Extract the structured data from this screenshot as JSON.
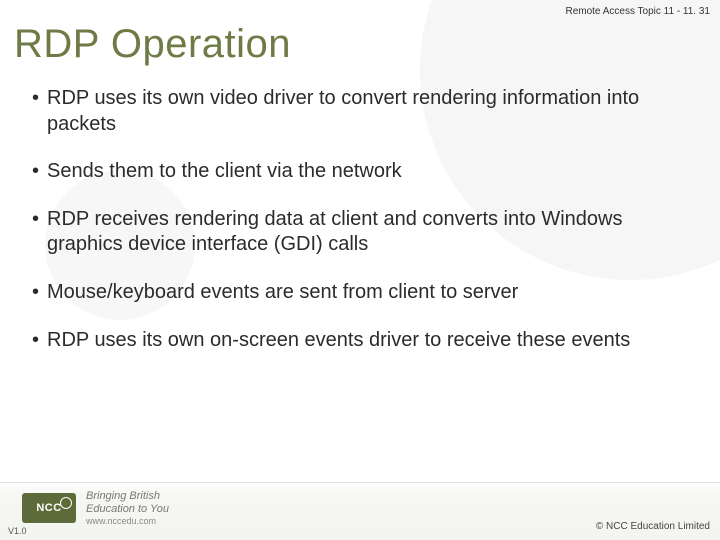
{
  "header": {
    "meta": "Remote Access  Topic 11 - 11. 31"
  },
  "title": "RDP Operation",
  "bullets": [
    "RDP uses its own video driver to convert rendering information into packets",
    "Sends them to the client via the network",
    "RDP receives rendering data at client and converts into Windows graphics device interface (GDI) calls",
    "Mouse/keyboard events are sent from client to server",
    "RDP uses its own on-screen events driver to receive these events"
  ],
  "footer": {
    "logo_text": "NCC",
    "tagline_line1": "Bringing British",
    "tagline_line2": "Education to You",
    "url": "www.nccedu.com",
    "version": "V1.0",
    "copyright": "©  NCC Education Limited"
  }
}
